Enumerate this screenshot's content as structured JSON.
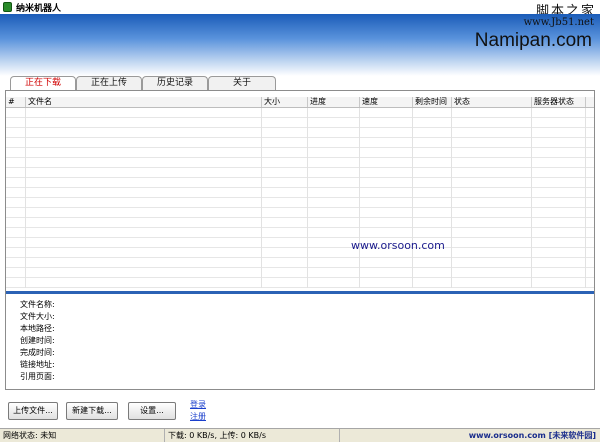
{
  "window": {
    "title": "纳米机器人"
  },
  "watermark": {
    "top": "脚本之家",
    "url": "www.Jb51.net"
  },
  "banner": {
    "brand": "Namipan.com"
  },
  "tabs": [
    {
      "label": "正在下载",
      "active": true
    },
    {
      "label": "正在上传",
      "active": false
    },
    {
      "label": "历史记录",
      "active": false
    },
    {
      "label": "关于",
      "active": false
    }
  ],
  "table": {
    "columns": [
      "#",
      "文件名",
      "大小",
      "进度",
      "速度",
      "剩余时间",
      "状态",
      "服务器状态"
    ],
    "rows": []
  },
  "center_watermark": "www.orsoon.com",
  "details": {
    "labels": [
      "文件名称:",
      "文件大小:",
      "本地路径:",
      "创建时间:",
      "完成时间:",
      "链接地址:",
      "引用页面:"
    ]
  },
  "buttons": {
    "upload": "上传文件...",
    "new_download": "新建下载...",
    "settings": "设置..."
  },
  "links": {
    "login": "登录",
    "register": "注册"
  },
  "status": {
    "network": "网络状态: 未知",
    "speed": "下载: 0 KB/s, 上传: 0 KB/s",
    "site": "www.orsoon.com [未来软件园]"
  }
}
